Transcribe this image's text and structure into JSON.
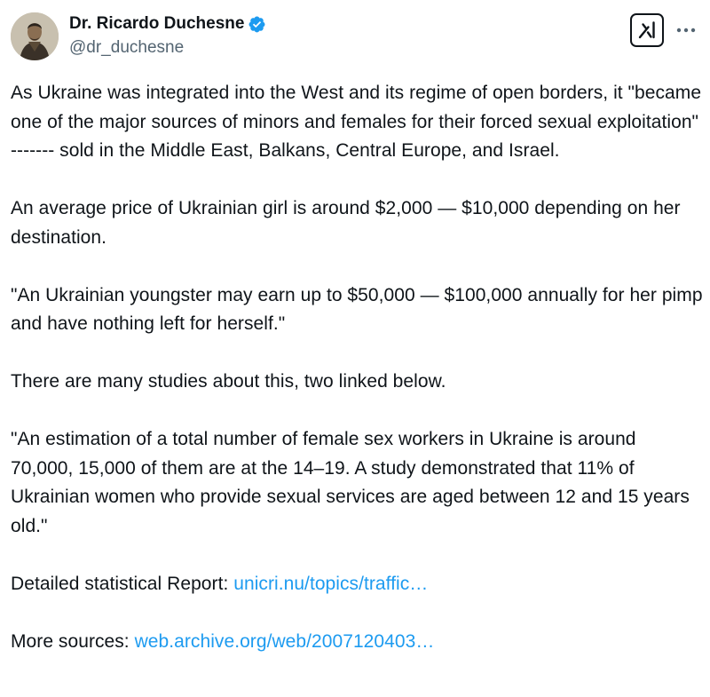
{
  "author": {
    "display_name": "Dr. Ricardo Duchesne",
    "handle": "@dr_duchesne",
    "verified": true,
    "verified_color": "#1d9bf0"
  },
  "header_icons": {
    "grok": "grok-icon",
    "more": "more-icon"
  },
  "colors": {
    "text": "#0f1419",
    "secondary": "#536471",
    "link": "#1d9bf0"
  },
  "tweet": {
    "paragraphs": [
      {
        "text": "As Ukraine was integrated into the West and its regime of open borders, it \"became one of the major sources of minors and females for their forced sexual exploitation\" ------- sold in the Middle East, Balkans, Central Europe, and Israel."
      },
      {
        "text": "An average price of Ukrainian girl is around $2,000 — $10,000 depending on her destination."
      },
      {
        "text": "\"An Ukrainian youngster may earn up to $50,000 — $100,000 annually for her pimp and have nothing left for herself.\""
      },
      {
        "text": "There are many studies about this, two linked below."
      },
      {
        "text": "\"An estimation of a total number of female sex workers in Ukraine is around 70,000, 15,000 of them are at the 14–19. A study demonstrated that 11% of Ukrainian women who provide sexual services are aged between 12 and 15 years old.\""
      }
    ],
    "links": [
      {
        "prefix": "Detailed statistical Report: ",
        "link_text": "unicri.nu/topics/traffic…"
      },
      {
        "prefix": "More sources: ",
        "link_text": "web.archive.org/web/2007120403…"
      }
    ]
  }
}
